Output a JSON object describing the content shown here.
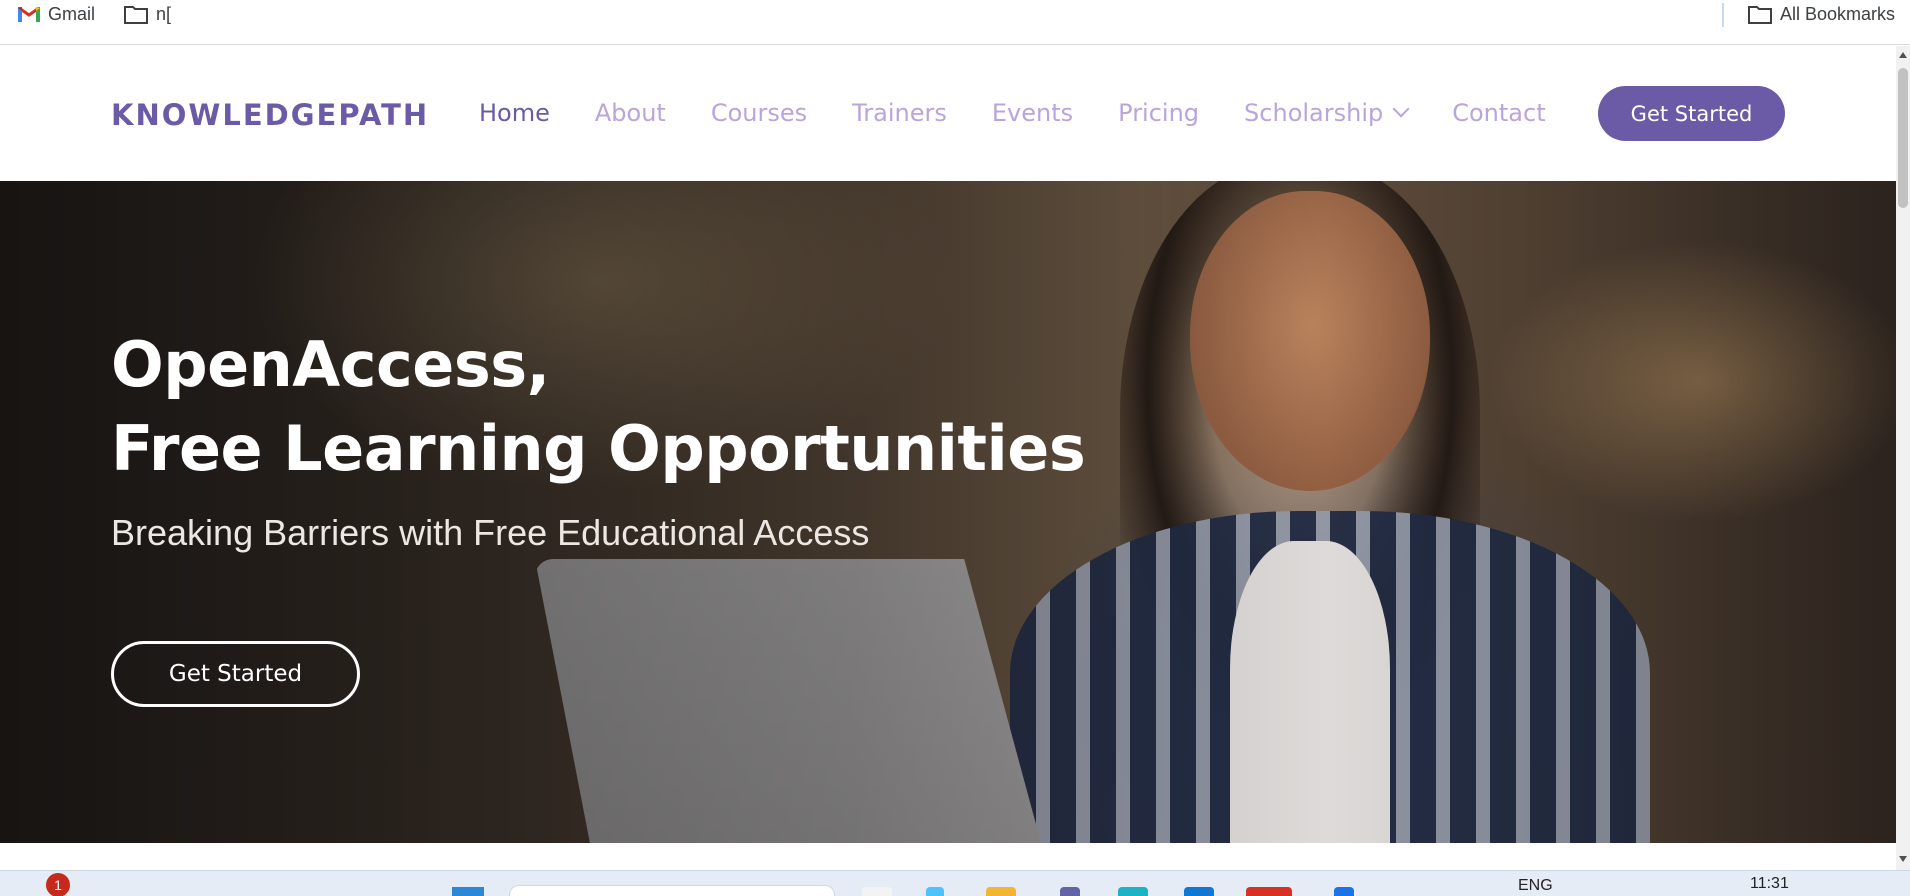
{
  "bookmarks": {
    "gmail_label": "Gmail",
    "folder1_label": "n[",
    "all_label": "All Bookmarks"
  },
  "site": {
    "logo": "KNOWLEDGEPATH",
    "nav": [
      "Home",
      "About",
      "Courses",
      "Trainers",
      "Events",
      "Pricing",
      "Scholarship",
      "Contact"
    ],
    "active_nav": "Home",
    "header_cta": "Get Started"
  },
  "hero": {
    "title_line1": "OpenAccess,",
    "title_line2": "Free Learning Opportunities",
    "subtitle": "Breaking Barriers with Free Educational Access",
    "cta": "Get Started"
  },
  "taskbar": {
    "notification_count": "1",
    "language": "ENG",
    "time": "11:31"
  },
  "colors": {
    "brand": "#6b5ba6",
    "nav_inactive": "#b9a4dc"
  },
  "icons": [
    "gmail-icon",
    "folder-icon",
    "chevron-down-icon",
    "windows-start-icon"
  ]
}
